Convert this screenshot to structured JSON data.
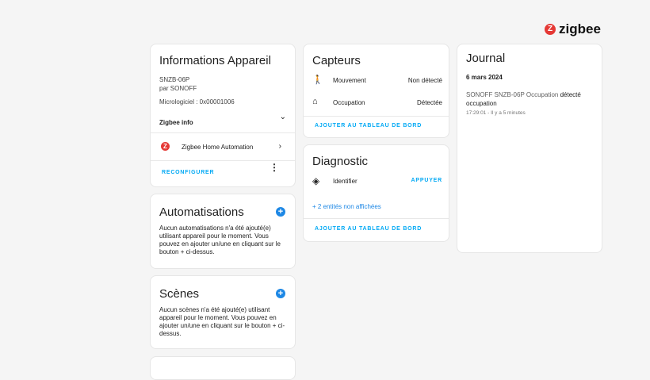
{
  "brand": {
    "name": "zigbee",
    "icon": "zigbee-icon",
    "color": "#e53935"
  },
  "device_info": {
    "title": "Informations Appareil",
    "model": "SNZB-06P",
    "manufacturer": "par SONOFF",
    "firmware": "Micrologiciel : 0x00001006",
    "zigbee_info_label": "Zigbee info",
    "integration_label": "Zigbee Home Automation",
    "reconfigure_label": "RECONFIGURER"
  },
  "automations": {
    "title": "Automatisations",
    "description": "Aucun automatisations n'a été ajouté(e) utilisant appareil pour le moment. Vous pouvez en ajouter un/une en cliquant sur le bouton + ci-dessus."
  },
  "scenes": {
    "title": "Scènes",
    "description": "Aucun scènes n'a été ajouté(e) utilisant appareil pour le moment. Vous pouvez en ajouter un/une en cliquant sur le bouton + ci-dessus."
  },
  "sensors": {
    "title": "Capteurs",
    "rows": [
      {
        "icon": "motion-icon",
        "label": "Mouvement",
        "value": "Non détecté"
      },
      {
        "icon": "home-icon",
        "label": "Occupation",
        "value": "Détectée"
      }
    ],
    "add_label": "AJOUTER AU TABLEAU DE BORD"
  },
  "diagnostic": {
    "title": "Diagnostic",
    "identify_label": "Identifier",
    "press_label": "APPUYER",
    "hidden_entities": "+ 2 entités non affichées",
    "add_label": "AJOUTER AU TABLEAU DE BORD"
  },
  "journal": {
    "title": "Journal",
    "date": "6 mars 2024",
    "entry_prefix": "SONOFF SNZB-06P Occupation",
    "entry_state": "détecté occupation",
    "entry_time": "17:29:01 - Il y a 5 minutes"
  }
}
